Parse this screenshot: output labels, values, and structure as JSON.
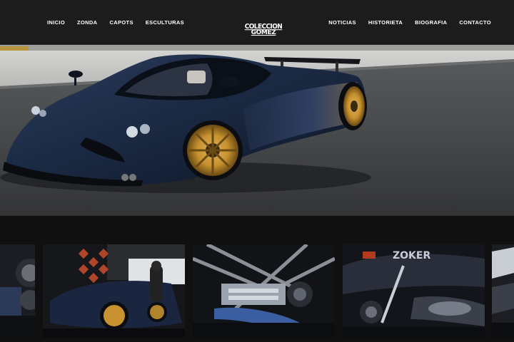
{
  "header": {
    "nav_left": [
      "INICIO",
      "ZONDA",
      "CAPOTS",
      "ESCULTURAS"
    ],
    "nav_right": [
      "NOTICIAS",
      "HISTORIETA",
      "BIOGRAFIA",
      "CONTACTO"
    ],
    "logo_line1": "COLECCION",
    "logo_line2": "GOMEZ"
  },
  "hero": {
    "subject": "car-photo",
    "car_color": "#1b2a44",
    "wheel_color": "#c7922f"
  },
  "gallery": {
    "items": [
      {
        "subject": "car-detail-photo"
      },
      {
        "subject": "car-garage-photo"
      },
      {
        "subject": "engine-photo"
      },
      {
        "subject": "engine-cover-photo",
        "label": "ZOKER"
      },
      {
        "subject": "car-detail-photo"
      }
    ]
  },
  "colors": {
    "header_bg": "#1c1c1d",
    "page_bg": "#111112",
    "nav_text": "#ffffff"
  }
}
